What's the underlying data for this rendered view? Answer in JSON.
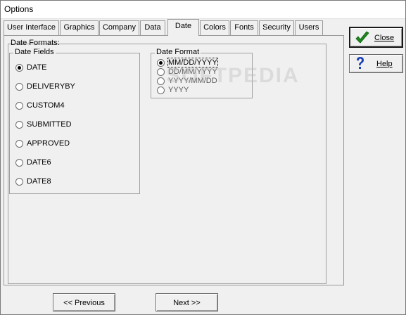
{
  "window": {
    "title": "Options"
  },
  "tabs": [
    {
      "label": "User Interface",
      "active": false
    },
    {
      "label": "Graphics",
      "active": false
    },
    {
      "label": "Company",
      "active": false
    },
    {
      "label": "Data",
      "active": false
    },
    {
      "label": "Date",
      "active": true
    },
    {
      "label": "Colors",
      "active": false
    },
    {
      "label": "Fonts",
      "active": false
    },
    {
      "label": "Security",
      "active": false
    },
    {
      "label": "Users",
      "active": false
    }
  ],
  "date_panel": {
    "section_label": "Date Formats:",
    "date_fields": {
      "legend": "Date Fields",
      "options": [
        "DATE",
        "DELIVERYBY",
        "CUSTOM4",
        "SUBMITTED",
        "APPROVED",
        "DATE6",
        "DATE8"
      ],
      "selected": "DATE"
    },
    "date_format": {
      "legend": "Date Format",
      "options": [
        "MM/DD/YYYY",
        "DD/MM/YYYY",
        "YYYY/MM/DD",
        "YYYY"
      ],
      "selected": "MM/DD/YYYY"
    }
  },
  "buttons": {
    "close": "Close",
    "help": "Help",
    "previous": "<< Previous",
    "next": "Next >>"
  },
  "icons": {
    "close": "checkmark-icon",
    "help": "question-mark-icon"
  },
  "colors": {
    "check_green": "#1a8a1a",
    "help_blue": "#1a3fb8"
  },
  "watermark": "SOFTPEDIA"
}
